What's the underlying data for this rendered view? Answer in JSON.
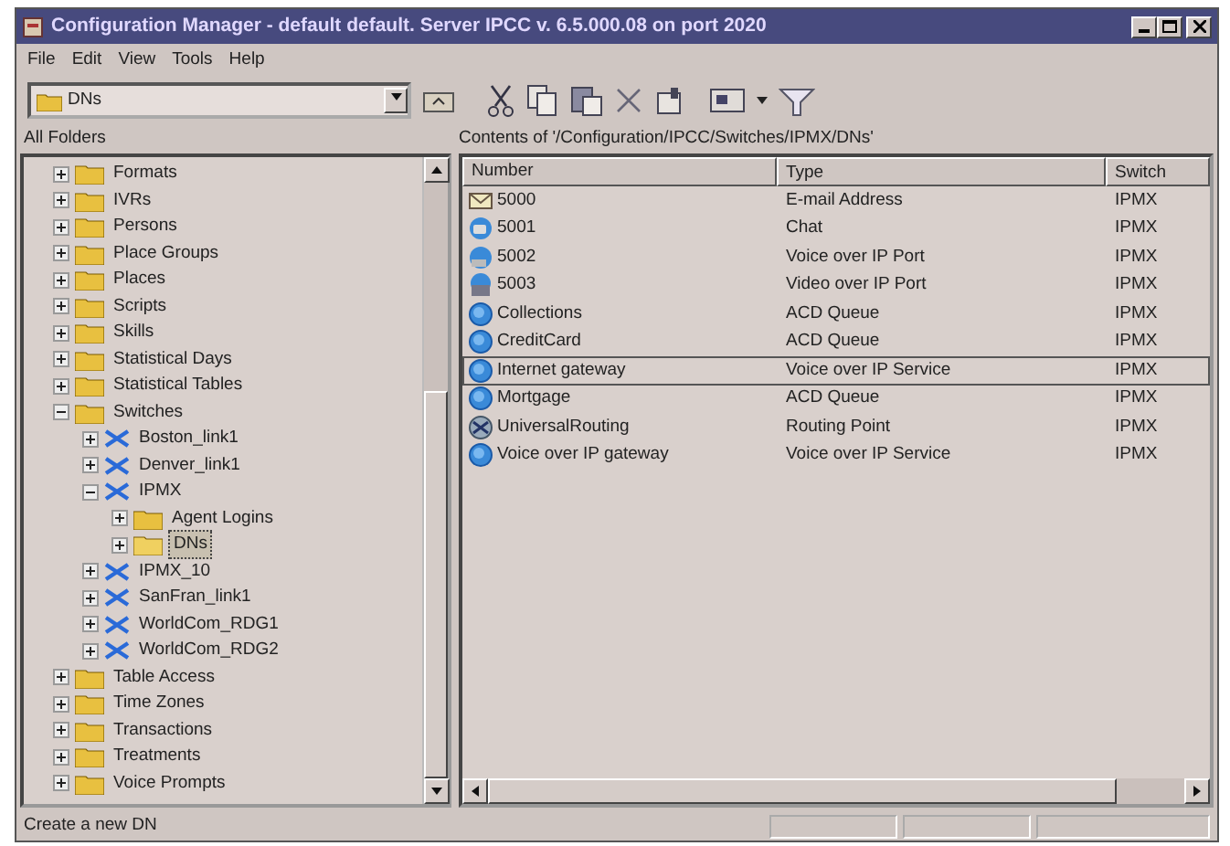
{
  "window": {
    "title": "Configuration Manager - default default. Server IPCC v. 6.5.000.08 on port 2020"
  },
  "menu": [
    "File",
    "Edit",
    "View",
    "Tools",
    "Help"
  ],
  "toolbar": {
    "folder_combo": {
      "value": "DNs"
    }
  },
  "tree": {
    "header": "All Folders",
    "items": [
      {
        "label": "Formats",
        "kind": "folder",
        "expanded": false
      },
      {
        "label": "IVRs",
        "kind": "folder",
        "expanded": false
      },
      {
        "label": "Persons",
        "kind": "folder",
        "expanded": false
      },
      {
        "label": "Place Groups",
        "kind": "folder",
        "expanded": false
      },
      {
        "label": "Places",
        "kind": "folder",
        "expanded": false
      },
      {
        "label": "Scripts",
        "kind": "folder",
        "expanded": false
      },
      {
        "label": "Skills",
        "kind": "folder",
        "expanded": false
      },
      {
        "label": "Statistical Days",
        "kind": "folder",
        "expanded": false
      },
      {
        "label": "Statistical Tables",
        "kind": "folder",
        "expanded": false
      },
      {
        "label": "Switches",
        "kind": "folder",
        "expanded": true,
        "children": [
          {
            "label": "Boston_link1",
            "kind": "switch",
            "expanded": false
          },
          {
            "label": "Denver_link1",
            "kind": "switch",
            "expanded": false
          },
          {
            "label": "IPMX",
            "kind": "switch",
            "expanded": true,
            "children": [
              {
                "label": "Agent Logins",
                "kind": "folder",
                "expanded": false,
                "selected": false
              },
              {
                "label": "DNs",
                "kind": "folder",
                "expanded": false,
                "selected": true
              }
            ]
          },
          {
            "label": "IPMX_10",
            "kind": "switch",
            "expanded": false
          },
          {
            "label": "SanFran_link1",
            "kind": "switch",
            "expanded": false
          },
          {
            "label": "WorldCom_RDG1",
            "kind": "switch",
            "expanded": false
          },
          {
            "label": "WorldCom_RDG2",
            "kind": "switch",
            "expanded": false
          }
        ]
      },
      {
        "label": "Table Access",
        "kind": "folder",
        "expanded": false
      },
      {
        "label": "Time Zones",
        "kind": "folder",
        "expanded": false
      },
      {
        "label": "Transactions",
        "kind": "folder",
        "expanded": false
      },
      {
        "label": "Treatments",
        "kind": "folder",
        "expanded": false
      },
      {
        "label": "Voice Prompts",
        "kind": "folder",
        "expanded": false
      }
    ]
  },
  "list": {
    "header": "Contents of '/Configuration/IPCC/Switches/IPMX/DNs'",
    "columns": [
      "Number",
      "Type",
      "Switch"
    ],
    "rows": [
      {
        "kind": "email",
        "number": "5000",
        "type": "E-mail Address",
        "switch": "IPMX",
        "focused": false
      },
      {
        "kind": "chat",
        "number": "5001",
        "type": "Chat",
        "switch": "IPMX",
        "focused": false
      },
      {
        "kind": "voip",
        "number": "5002",
        "type": "Voice over IP Port",
        "switch": "IPMX",
        "focused": false
      },
      {
        "kind": "video",
        "number": "5003",
        "type": "Video over IP Port",
        "switch": "IPMX",
        "focused": false
      },
      {
        "kind": "queue",
        "number": "Collections",
        "type": "ACD Queue",
        "switch": "IPMX",
        "focused": false
      },
      {
        "kind": "queue",
        "number": "CreditCard",
        "type": "ACD Queue",
        "switch": "IPMX",
        "focused": false
      },
      {
        "kind": "queue",
        "number": "Internet gateway",
        "type": "Voice over IP Service",
        "switch": "IPMX",
        "focused": true
      },
      {
        "kind": "queue",
        "number": "Mortgage",
        "type": "ACD Queue",
        "switch": "IPMX",
        "focused": false
      },
      {
        "kind": "routing",
        "number": "UniversalRouting",
        "type": "Routing Point",
        "switch": "IPMX",
        "focused": false
      },
      {
        "kind": "queue",
        "number": "Voice over IP gateway",
        "type": "Voice over IP Service",
        "switch": "IPMX",
        "focused": false
      }
    ]
  },
  "status_bar": {
    "text": "Create a new DN"
  }
}
